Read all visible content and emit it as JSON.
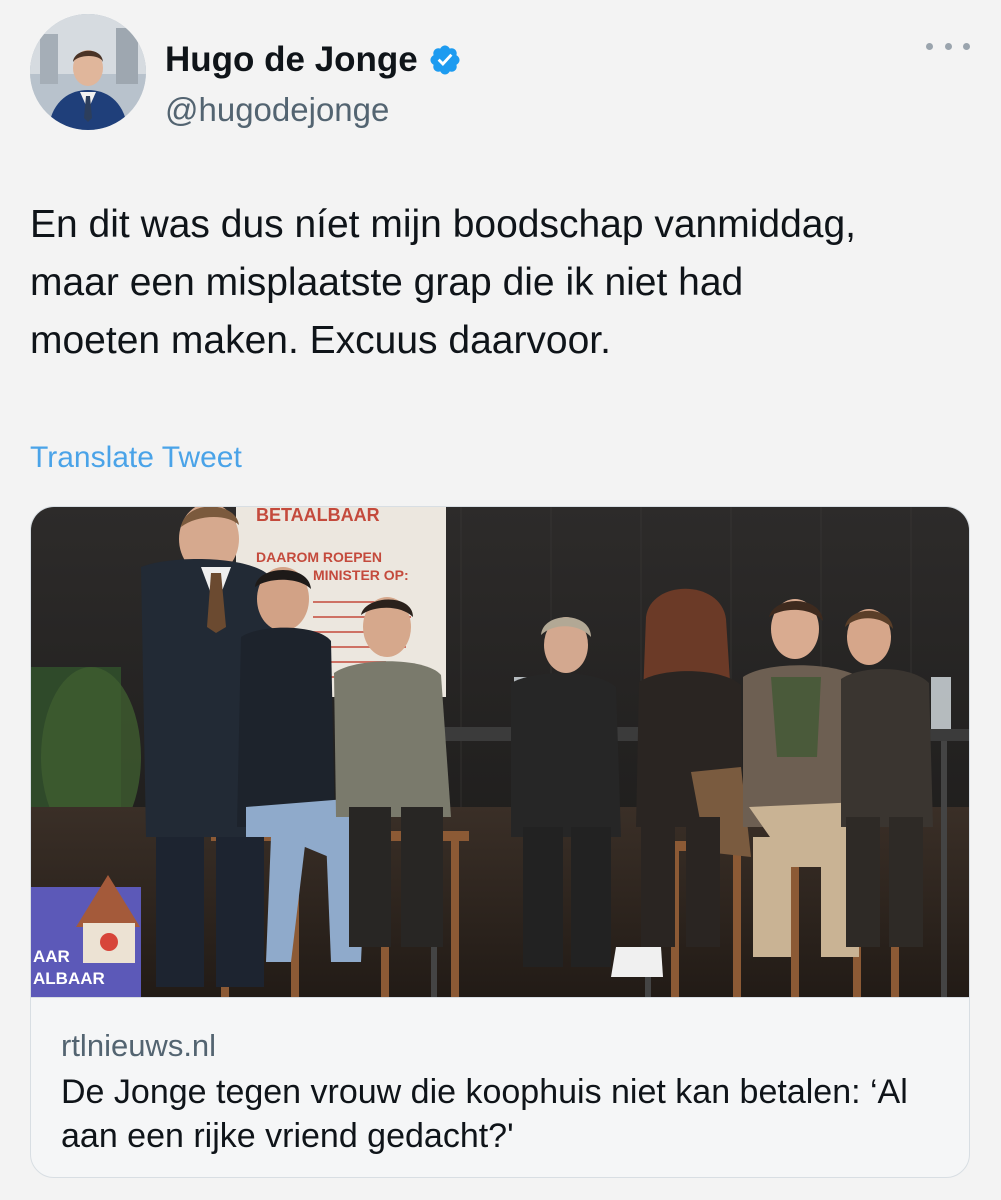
{
  "author": {
    "name": "Hugo de Jonge",
    "handle": "@hugodejonge",
    "verified": true
  },
  "tweet": {
    "text": "En dit was dus níet mijn boodschap vanmiddag,\nmaar een misplaatste grap die ik niet had\nmoeten maken. Excuus daarvoor.",
    "translate_label": "Translate Tweet"
  },
  "link_card": {
    "domain": "rtlnieuws.nl",
    "title": "De Jonge tegen vrouw die koophuis niet kan betalen: ‘Al aan een rijke vriend gedacht?'",
    "banner_text": {
      "top": "BETAALBAAR",
      "line1": "DAAROM ROEPEN",
      "line2": "MINISTER OP:",
      "bottom_left": "AAR",
      "bottom_left2": "ALBAAR"
    }
  },
  "icons": {
    "verified": "verified-badge-icon",
    "more": "more-options-icon"
  },
  "colors": {
    "background": "#f3f3f3",
    "link": "#4aa3e8",
    "verified": "#1d9bf0",
    "secondary_text": "#536471"
  }
}
